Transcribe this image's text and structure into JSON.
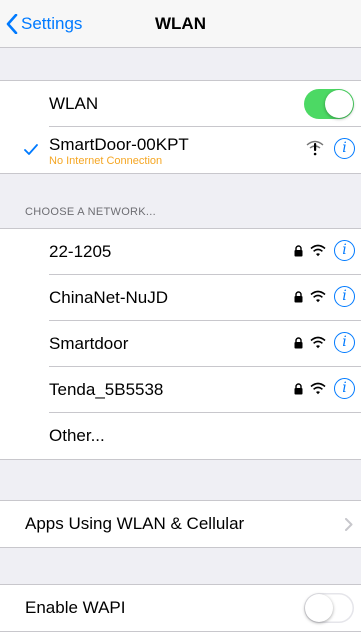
{
  "navbar": {
    "back_label": "Settings",
    "title": "WLAN"
  },
  "wlan_toggle": {
    "label": "WLAN",
    "on": true
  },
  "connected": {
    "ssid": "SmartDoor-00KPT",
    "status": "No Internet Connection"
  },
  "section_header": "CHOOSE A NETWORK...",
  "networks": [
    {
      "ssid": "22-1205"
    },
    {
      "ssid": "ChinaNet-NuJD"
    },
    {
      "ssid": "Smartdoor"
    },
    {
      "ssid": "Tenda_5B5538"
    }
  ],
  "other_label": "Other...",
  "apps_using": {
    "label": "Apps Using WLAN & Cellular"
  },
  "enable_wapi": {
    "label": "Enable WAPI",
    "on": false
  },
  "colors": {
    "accent": "#007aff",
    "switch_on": "#4cd964",
    "warning": "#f5a623"
  },
  "icons": [
    "chevron-left-icon",
    "checkmark-icon",
    "wifi-warning-icon",
    "lock-icon",
    "wifi-icon",
    "info-icon",
    "chevron-right-icon"
  ]
}
